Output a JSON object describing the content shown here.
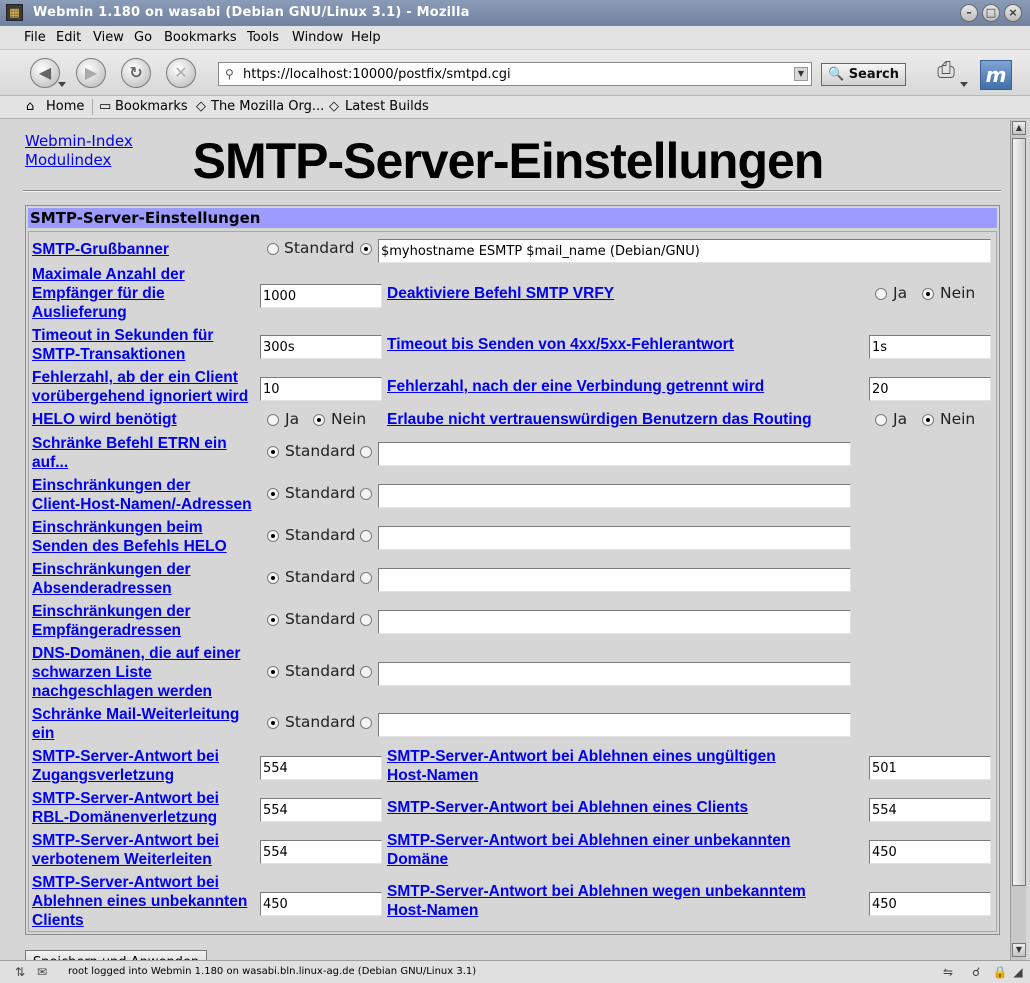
{
  "window": {
    "title": "Webmin 1.180 on wasabi (Debian GNU/Linux 3.1) - Mozilla"
  },
  "menu": [
    "File",
    "Edit",
    "View",
    "Go",
    "Bookmarks",
    "Tools",
    "Window",
    "Help"
  ],
  "toolbar": {
    "url": "https://localhost:10000/postfix/smtpd.cgi",
    "search_label": "Search"
  },
  "personal_bar": {
    "home": "Home",
    "bookmarks": "Bookmarks",
    "mozilla_org": "The Mozilla Org...",
    "latest_builds": "Latest Builds"
  },
  "page": {
    "webmin_index": "Webmin-Index",
    "module_index": "Modulindex",
    "title": "SMTP-Server-Einstellungen",
    "panel_title": "SMTP-Server-Einstellungen",
    "opt_default": "Standard",
    "opt_yes": "Ja",
    "opt_no": "Nein",
    "save_button": "Speichern und Anwenden"
  },
  "fields": {
    "banner_label_1": "SMTP-Grußbanner",
    "banner_value": "$myhostname ESMTP $mail_name (Debian/GNU)",
    "max_rcpt_label_1": "Maximale Anzahl der",
    "max_rcpt_label_2": "Empfänger für die",
    "max_rcpt_label_3": "Auslieferung",
    "max_rcpt_value": "1000",
    "vrfy_label": "Deaktiviere Befehl SMTP VRFY",
    "timeout_label_1": "Timeout in Sekunden für",
    "timeout_label_2": "SMTP-Transaktionen",
    "timeout_value": "300s",
    "error_timeout_label": "Timeout bis Senden von 4xx/5xx-Fehlerantwort",
    "error_timeout_value": "1s",
    "soft_error_label_1": "Fehlerzahl, ab der ein Client",
    "soft_error_label_2": "vorübergehend ignoriert wird",
    "soft_error_value": "10",
    "hard_error_label": "Fehlerzahl, nach der eine Verbindung getrennt wird",
    "hard_error_value": "20",
    "helo_required_label": "HELO wird benötigt",
    "relay_untrusted_label": "Erlaube nicht vertrauenswürdigen Benutzern das Routing",
    "etrn_label_1": "Schränke Befehl ETRN ein",
    "etrn_label_2": "auf...",
    "client_label_1": "Einschränkungen der",
    "client_label_2": "Client-Host-Namen/-Adressen",
    "helo_label_1": "Einschränkungen beim",
    "helo_label_2": "Senden des Befehls HELO",
    "sender_label_1": "Einschränkungen der",
    "sender_label_2": "Absenderadressen",
    "recipient_label_1": "Einschränkungen der",
    "recipient_label_2": "Empfängeradressen",
    "dns_label_1": "DNS-Domänen, die auf einer",
    "dns_label_2": "schwarzen Liste",
    "dns_label_3": "nachgeschlagen werden",
    "relay_label_1": "Schränke Mail-Weiterleitung",
    "relay_label_2": "ein",
    "access_reject_label_1": "SMTP-Server-Antwort bei",
    "access_reject_label_2": "Zugangsverletzung",
    "access_reject_value": "554",
    "invalid_host_label_1": "SMTP-Server-Antwort bei Ablehnen eines ungültigen",
    "invalid_host_label_2": "Host-Namen",
    "invalid_host_value": "501",
    "rbl_label_1": "SMTP-Server-Antwort bei",
    "rbl_label_2": "RBL-Domänenverletzung",
    "rbl_value": "554",
    "reject_client_label": "SMTP-Server-Antwort bei Ablehnen eines Clients",
    "reject_client_value": "554",
    "relay_denied_label_1": "SMTP-Server-Antwort bei",
    "relay_denied_label_2": "verbotenem Weiterleiten",
    "relay_denied_value": "554",
    "unknown_domain_label_1": "SMTP-Server-Antwort bei Ablehnen einer unbekannten",
    "unknown_domain_label_2": "Domäne",
    "unknown_domain_value": "450",
    "unknown_client_label_1": "SMTP-Server-Antwort bei",
    "unknown_client_label_2": "Ablehnen eines unbekannten",
    "unknown_client_label_3": "Clients",
    "unknown_client_value": "450",
    "unknown_host_label_1": "SMTP-Server-Antwort bei Ablehnen wegen unbekanntem",
    "unknown_host_label_2": "Host-Namen",
    "unknown_host_value": "450"
  },
  "status": {
    "text": "root logged into Webmin 1.180 on wasabi.bln.linux-ag.de (Debian GNU/Linux 3.1)"
  }
}
